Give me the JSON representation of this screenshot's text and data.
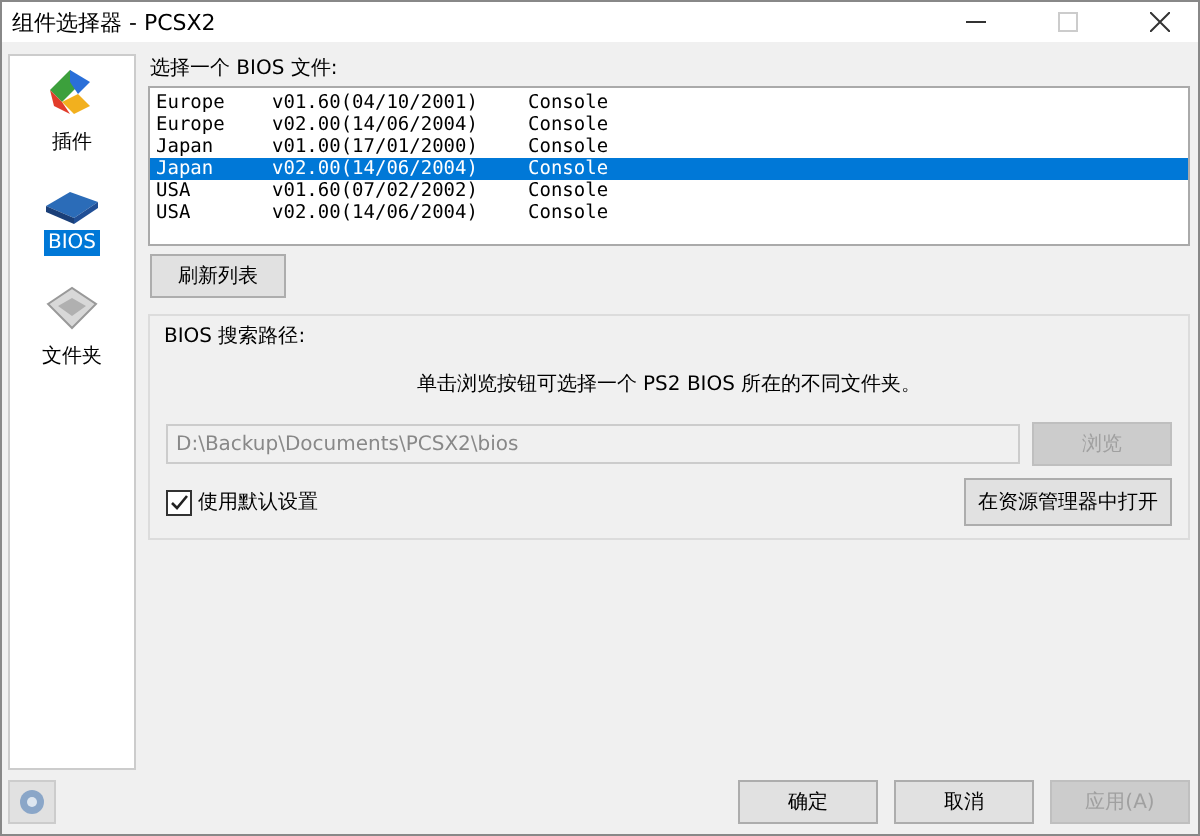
{
  "window": {
    "title": "组件选择器 - PCSX2"
  },
  "sidebar": {
    "items": [
      {
        "label": "插件",
        "kind": "plugins",
        "selected": false
      },
      {
        "label": "BIOS",
        "kind": "chip",
        "selected": true
      },
      {
        "label": "文件夹",
        "kind": "folder",
        "selected": false
      }
    ]
  },
  "bios_list": {
    "label": "选择一个 BIOS 文件:",
    "rows": [
      {
        "region": "Europe",
        "version": "v01.60(04/10/2001)",
        "type": "Console",
        "selected": false
      },
      {
        "region": "Europe",
        "version": "v02.00(14/06/2004)",
        "type": "Console",
        "selected": false
      },
      {
        "region": "Japan",
        "version": "v01.00(17/01/2000)",
        "type": "Console",
        "selected": false
      },
      {
        "region": "Japan",
        "version": "v02.00(14/06/2004)",
        "type": "Console",
        "selected": true
      },
      {
        "region": "USA",
        "version": "v01.60(07/02/2002)",
        "type": "Console",
        "selected": false
      },
      {
        "region": "USA",
        "version": "v02.00(14/06/2004)",
        "type": "Console",
        "selected": false
      }
    ]
  },
  "refresh_button": "刷新列表",
  "search_path": {
    "title": "BIOS 搜索路径:",
    "hint": "单击浏览按钮可选择一个 PS2 BIOS 所在的不同文件夹。",
    "path": "D:\\Backup\\Documents\\PCSX2\\bios",
    "path_disabled": true,
    "browse": {
      "label": "浏览",
      "disabled": true
    },
    "use_default": {
      "label": "使用默认设置",
      "checked": true
    },
    "open_explorer": "在资源管理器中打开"
  },
  "buttons": [
    {
      "label": "确定",
      "disabled": false
    },
    {
      "label": "取消",
      "disabled": false
    },
    {
      "label": "应用(A)",
      "disabled": true
    }
  ]
}
